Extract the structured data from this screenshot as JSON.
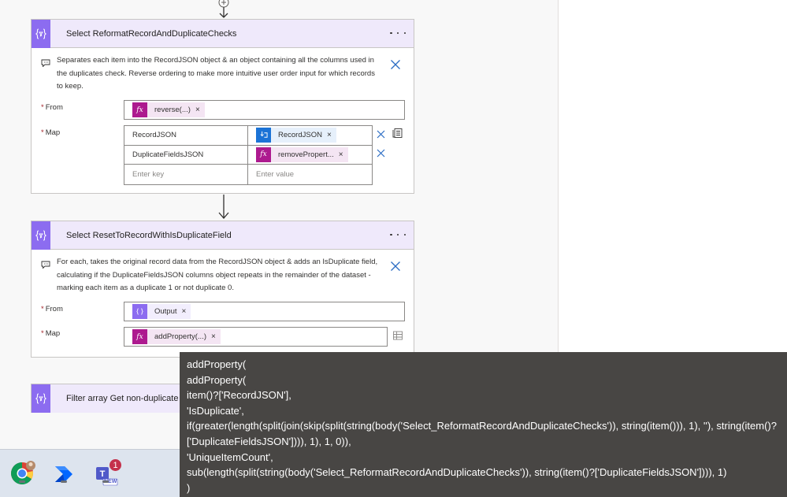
{
  "colors": {
    "operation_accent": "#8c6cf0",
    "header_bg": "#efe9fb",
    "expression_token": "#ad1a8f",
    "dynamic_token": "#1b73d6"
  },
  "card1": {
    "title": "Select ReformatRecordAndDuplicateChecks",
    "note": "Separates each item into the RecordJSON object & an object containing all the columns used in the duplicates check. Reverse ordering to make more intuitive user order input for which records to keep.",
    "from_label": "From",
    "from_token": "reverse(...)",
    "map_label": "Map",
    "map_rows": [
      {
        "key": "RecordJSON",
        "value": "RecordJSON",
        "token_type": "dynamic"
      },
      {
        "key": "DuplicateFieldsJSON",
        "value": "removePropert...",
        "token_type": "expression"
      }
    ],
    "key_placeholder": "Enter key",
    "value_placeholder": "Enter value"
  },
  "card2": {
    "title": "Select ResetToRecordWithIsDuplicateField",
    "note": "For each, takes the original record data from the RecordJSON object & adds an IsDuplicate field, calculating if the DuplicateFieldsJSON columns object repeats in the remainder of the dataset - marking each item as a duplicate 1 or not duplicate 0.",
    "from_label": "From",
    "from_token": "Output",
    "map_label": "Map",
    "map_token": "addProperty(...)"
  },
  "card3": {
    "title": "Filter array Get non-duplicate"
  },
  "token_remove": "×",
  "tooltip": {
    "lines": [
      "addProperty(",
      "addProperty(",
      "item()?['RecordJSON'],",
      "'IsDuplicate',",
      "if(greater(length(split(join(skip(split(string(body('Select_ReformatRecordAndDuplicateChecks')), string(item())), 1), ''), string(item()?['DuplicateFieldsJSON']))), 1), 1, 0)),",
      "'UniqueItemCount',",
      "sub(length(split(string(body('Select_ReformatRecordAndDuplicateChecks')), string(item()?['DuplicateFieldsJSON']))), 1)",
      ")"
    ]
  },
  "taskbar": {
    "apps": [
      {
        "name": "chrome"
      },
      {
        "name": "power-automate"
      },
      {
        "name": "teams",
        "badge": "1",
        "tag": "NEW"
      }
    ]
  }
}
